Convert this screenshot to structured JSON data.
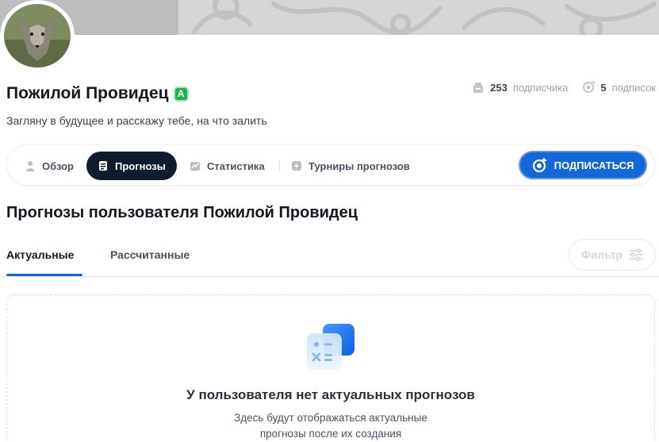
{
  "profile": {
    "name": "Пожилой Провидец",
    "badge": "A",
    "bio": "Загляну в будущее и расскажу тебе, на что залить",
    "subscribers_count": "253",
    "subscribers_label": "подписчика",
    "subscriptions_count": "5",
    "subscriptions_label": "подписок"
  },
  "nav": {
    "tabs": [
      {
        "label": "Обзор",
        "icon": "user-icon"
      },
      {
        "label": "Прогнозы",
        "icon": "document-icon",
        "active": true
      },
      {
        "label": "Статистика",
        "icon": "chart-icon"
      },
      {
        "label": "Турниры прогнозов",
        "icon": "lightning-icon"
      }
    ],
    "subscribe_label": "ПОДПИСАТЬСЯ"
  },
  "main": {
    "title": "Прогнозы пользователя Пожилой Провидец",
    "subtabs": [
      {
        "label": "Актуальные",
        "active": true
      },
      {
        "label": "Рассчитанные",
        "active": false
      }
    ],
    "filter_label": "Фильтр",
    "empty_title": "У пользователя нет актуальных прогнозов",
    "empty_text_line1": "Здесь будут отображаться актуальные",
    "empty_text_line2": "прогнозы после их создания"
  },
  "colors": {
    "accent": "#1566d6",
    "active_tab": "#0f1c2e",
    "badge": "#1fb34f"
  }
}
